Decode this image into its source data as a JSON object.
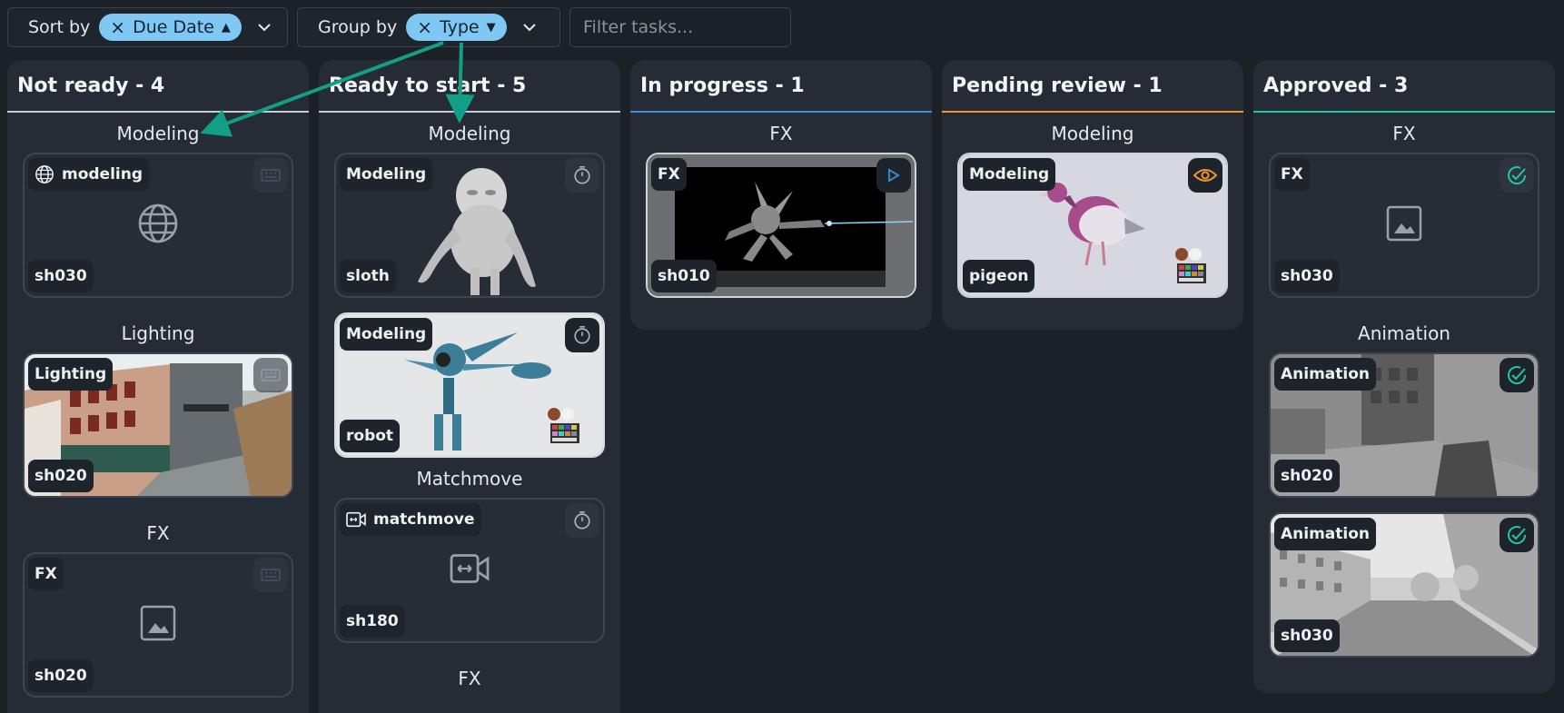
{
  "toolbar": {
    "sort_label": "Sort by",
    "sort_value": "Due Date",
    "group_label": "Group by",
    "group_value": "Type",
    "filter_placeholder": "Filter tasks..."
  },
  "colors": {
    "not_ready": "#c7ccd3",
    "ready": "#c7ccd3",
    "in_progress": "#3a8fd8",
    "pending_review": "#f0962e",
    "approved": "#25c4a8",
    "annotation_arrow": "#139f87"
  },
  "columns": [
    {
      "title": "Not ready - 4",
      "groups": [
        {
          "title": "Modeling",
          "cards": [
            {
              "type": "modeling",
              "shot": "sh030",
              "icon": "globe-icon",
              "status_icon": "not-ready-icon"
            }
          ]
        },
        {
          "title": "Lighting",
          "cards": [
            {
              "type": "Lighting",
              "shot": "sh020",
              "thumbnail": "city-street-render",
              "status_icon": "not-ready-icon"
            }
          ]
        },
        {
          "title": "FX",
          "cards": [
            {
              "type": "FX",
              "shot": "sh020",
              "icon": "image-placeholder-icon",
              "status_icon": "not-ready-icon"
            }
          ]
        }
      ]
    },
    {
      "title": "Ready to start - 5",
      "groups": [
        {
          "title": "Modeling",
          "cards": [
            {
              "type": "Modeling",
              "shot": "sloth",
              "thumbnail": "sloth-model",
              "status_icon": "timer-icon"
            },
            {
              "type": "Modeling",
              "shot": "robot",
              "thumbnail": "robot-model",
              "status_icon": "timer-icon"
            }
          ]
        },
        {
          "title": "Matchmove",
          "cards": [
            {
              "type": "matchmove",
              "shot": "sh180",
              "icon": "matchmove-icon",
              "status_icon": "timer-icon"
            }
          ]
        },
        {
          "title": "FX",
          "cards": []
        }
      ]
    },
    {
      "title": "In progress - 1",
      "groups": [
        {
          "title": "FX",
          "cards": [
            {
              "type": "FX",
              "shot": "sh010",
              "thumbnail": "robot-laser-render",
              "status_icon": "play-icon"
            }
          ]
        }
      ]
    },
    {
      "title": "Pending review - 1",
      "groups": [
        {
          "title": "Modeling",
          "cards": [
            {
              "type": "Modeling",
              "shot": "pigeon",
              "thumbnail": "pigeon-model",
              "status_icon": "eye-icon"
            }
          ]
        }
      ]
    },
    {
      "title": "Approved - 3",
      "groups": [
        {
          "title": "FX",
          "cards": [
            {
              "type": "FX",
              "shot": "sh030",
              "icon": "image-placeholder-icon",
              "status_icon": "check-circle-icon"
            }
          ]
        },
        {
          "title": "Animation",
          "cards": [
            {
              "type": "Animation",
              "shot": "sh020",
              "thumbnail": "grey-city-render",
              "status_icon": "check-circle-icon"
            },
            {
              "type": "Animation",
              "shot": "sh030",
              "thumbnail": "grey-street-render",
              "status_icon": "check-circle-icon"
            }
          ]
        }
      ]
    }
  ]
}
